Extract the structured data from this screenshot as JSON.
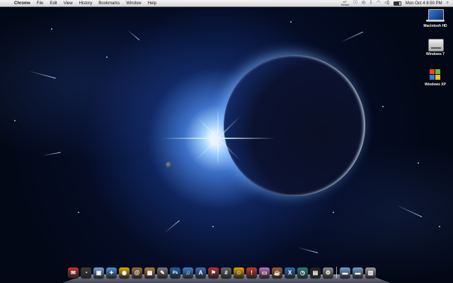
{
  "menubar": {
    "apple_glyph": "",
    "app_name": "Chrome",
    "menus": [
      "File",
      "Edit",
      "View",
      "History",
      "Bookmarks",
      "Window",
      "Help"
    ],
    "weather_temp": "42°",
    "weather_city": "Toronto",
    "datetime": "Mon Oct 4  8:50 PM",
    "battery_level": 0.8
  },
  "desktop": {
    "drives": [
      {
        "label": "Macintosh HD",
        "icon": "laptop-drive-icon"
      },
      {
        "label": "Windows 7",
        "icon": "hard-disk-icon"
      },
      {
        "label": "Windows XP",
        "icon": "windows-flag-icon"
      }
    ]
  },
  "dock": {
    "items": [
      {
        "name": "mail",
        "icon": "mail-stamp-icon",
        "color": "#c9302c",
        "glyph": "✉"
      },
      {
        "name": "dashboard",
        "icon": "dashboard-icon",
        "color": "#3b3b3b",
        "glyph": "◔"
      },
      {
        "name": "preview",
        "icon": "preview-icon",
        "color": "#6fa3d8",
        "glyph": "▣"
      },
      {
        "name": "safari",
        "icon": "safari-compass-icon",
        "color": "#4a90d9",
        "glyph": "✦"
      },
      {
        "name": "chrome",
        "icon": "chrome-icon",
        "color": "#e0a800",
        "glyph": "◉"
      },
      {
        "name": "address-book",
        "icon": "address-book-icon",
        "color": "#9a6b3e",
        "glyph": "@"
      },
      {
        "name": "iphoto",
        "icon": "iphoto-icon",
        "color": "#b07b3a",
        "glyph": "▦"
      },
      {
        "name": "sketch",
        "icon": "pencil-icon",
        "color": "#777777",
        "glyph": "✎"
      },
      {
        "name": "photoshop",
        "icon": "photoshop-icon",
        "color": "#1c5fa8",
        "glyph": "Ps"
      },
      {
        "name": "itunes",
        "icon": "itunes-note-icon",
        "color": "#3a7fd0",
        "glyph": "♫"
      },
      {
        "name": "app-store",
        "icon": "app-store-icon",
        "color": "#2f6fb5",
        "glyph": "A"
      },
      {
        "name": "flag-app",
        "icon": "flag-icon",
        "color": "#b8332c",
        "glyph": "⚑"
      },
      {
        "name": "calculator",
        "icon": "calculator-icon",
        "color": "#666666",
        "glyph": "#"
      },
      {
        "name": "adium",
        "icon": "smiley-icon",
        "color": "#e6a300",
        "glyph": "☺"
      },
      {
        "name": "mail-alert",
        "icon": "alert-icon",
        "color": "#c0392b",
        "glyph": "!"
      },
      {
        "name": "display",
        "icon": "monitor-icon",
        "color": "#c070c0",
        "glyph": "▭"
      },
      {
        "name": "coffee",
        "icon": "coffee-icon",
        "color": "#a05a2c",
        "glyph": "☕"
      },
      {
        "name": "xcode",
        "icon": "xcode-icon",
        "color": "#2a6cb0",
        "glyph": "X"
      },
      {
        "name": "clock",
        "icon": "clock-icon",
        "color": "#2a8080",
        "glyph": "◷"
      },
      {
        "name": "activity-monitor",
        "icon": "activity-monitor-icon",
        "color": "#222222",
        "glyph": "▤"
      },
      {
        "name": "system-preferences",
        "icon": "gear-icon",
        "color": "#8a8a8a",
        "glyph": "⚙"
      },
      {
        "name": "applications-folder",
        "icon": "folder-icon",
        "color": "#6f9fd0",
        "glyph": "▬"
      },
      {
        "name": "documents-folder",
        "icon": "folder-icon",
        "color": "#6f9fd0",
        "glyph": "▬"
      },
      {
        "name": "trash",
        "icon": "trash-icon",
        "color": "#9a9a9a",
        "glyph": "▥"
      }
    ]
  }
}
